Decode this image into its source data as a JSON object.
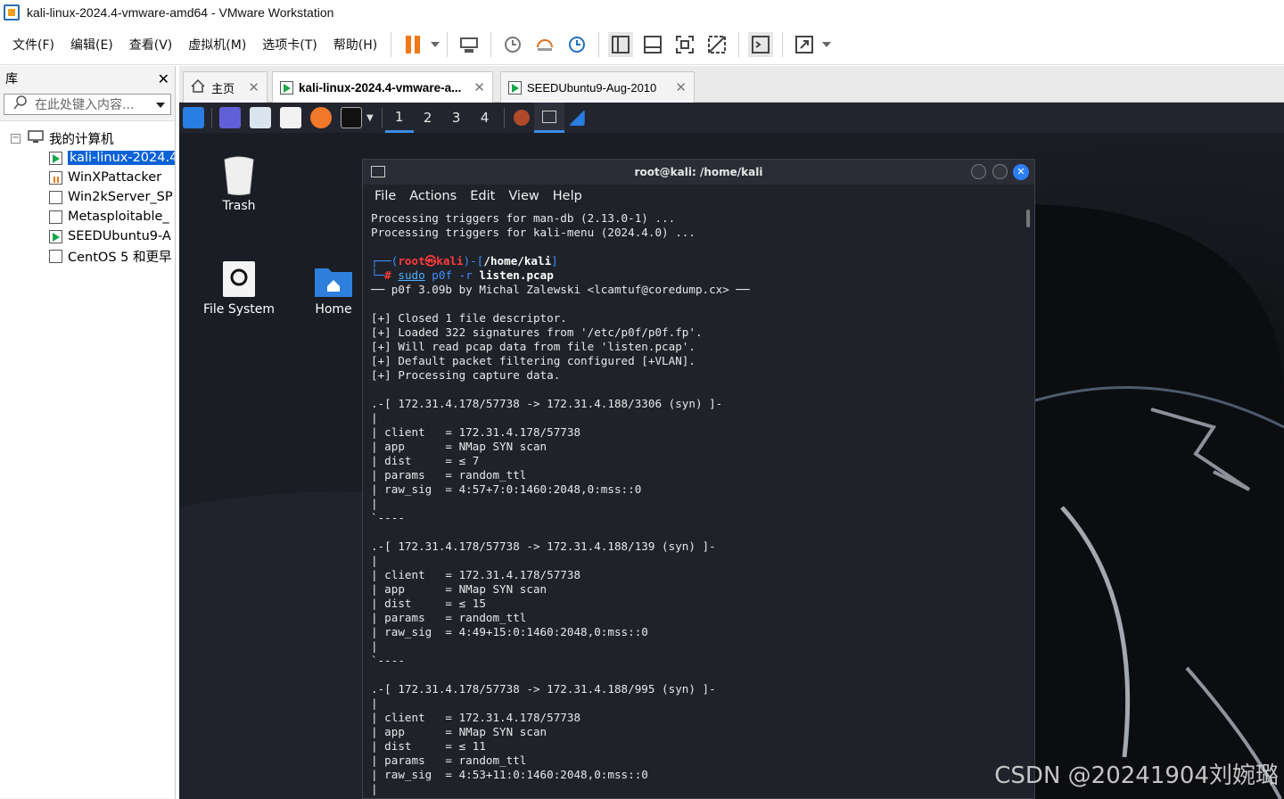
{
  "window": {
    "title": "kali-linux-2024.4-vmware-amd64 - VMware Workstation"
  },
  "menu": [
    "文件(F)",
    "编辑(E)",
    "查看(V)",
    "虚拟机(M)",
    "选项卡(T)",
    "帮助(H)"
  ],
  "library": {
    "header": "库",
    "search_placeholder": "在此处键入内容...",
    "root": "我的计算机",
    "items": [
      "kali-linux-2024.4",
      "WinXPattacker",
      "Win2kServer_SP",
      "Metasploitable_",
      "SEEDUbuntu9-A",
      "CentOS 5 和更早"
    ]
  },
  "tabs": [
    {
      "label": "主页"
    },
    {
      "label": "kali-linux-2024.4-vmware-a..."
    },
    {
      "label": "SEEDUbuntu9-Aug-2010"
    }
  ],
  "vm": {
    "workspaces": [
      "1",
      "2",
      "3",
      "4"
    ],
    "desktop_icons": [
      "Trash",
      "File System",
      "Home"
    ],
    "terminal": {
      "title": "root@kali: /home/kali",
      "menu": [
        "File",
        "Actions",
        "Edit",
        "View",
        "Help"
      ],
      "lines_top": "Processing triggers for man-db (2.13.0-1) ...\nProcessing triggers for kali-menu (2024.4.0) ...",
      "prompt_user": "root㉿kali",
      "prompt_dir": "/home/kali",
      "cmd_sudo": "sudo",
      "cmd_rest": "p0f -r",
      "cmd_file": "listen.pcap",
      "output": "── p0f 3.09b by Michal Zalewski <lcamtuf@coredump.cx> ──\n\n[+] Closed 1 file descriptor.\n[+] Loaded 322 signatures from '/etc/p0f/p0f.fp'.\n[+] Will read pcap data from file 'listen.pcap'.\n[+] Default packet filtering configured [+VLAN].\n[+] Processing capture data.\n\n.-[ 172.31.4.178/57738 -> 172.31.4.188/3306 (syn) ]-\n|\n| client   = 172.31.4.178/57738\n| app      = NMap SYN scan\n| dist     = ≤ 7\n| params   = random_ttl\n| raw_sig  = 4:57+7:0:1460:2048,0:mss::0\n|\n`----\n\n.-[ 172.31.4.178/57738 -> 172.31.4.188/139 (syn) ]-\n|\n| client   = 172.31.4.178/57738\n| app      = NMap SYN scan\n| dist     = ≤ 15\n| params   = random_ttl\n| raw_sig  = 4:49+15:0:1460:2048,0:mss::0\n|\n`----\n\n.-[ 172.31.4.178/57738 -> 172.31.4.188/995 (syn) ]-\n|\n| client   = 172.31.4.178/57738\n| app      = NMap SYN scan\n| dist     = ≤ 11\n| params   = random_ttl\n| raw_sig  = 4:53+11:0:1460:2048,0:mss::0\n|"
    }
  },
  "watermark": "CSDN @20241904刘婉璐"
}
